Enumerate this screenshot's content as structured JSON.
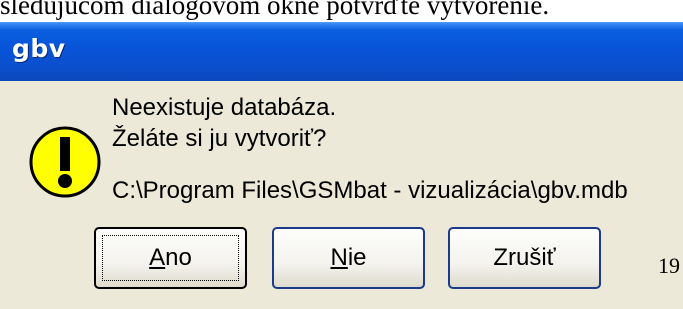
{
  "document": {
    "caption_line": "sledujúcom dialógovom okne potvrďte vytvorenie."
  },
  "dialog": {
    "title": "gbv",
    "message_line1": "Neexistuje databáza.",
    "message_line2": "Želáte si ju vytvoriť?",
    "path": "C:\\Program Files\\GSMbat - vizualizácia\\gbv.mdb",
    "icon": "exclamation-icon",
    "icon_color": "#ffff00"
  },
  "buttons": {
    "ano_mnemonic": "A",
    "ano_rest": "no",
    "nie_mnemonic": "N",
    "nie_rest": "ie",
    "zrusit_label": "Zrušiť"
  },
  "page": {
    "corner_number": "19"
  }
}
